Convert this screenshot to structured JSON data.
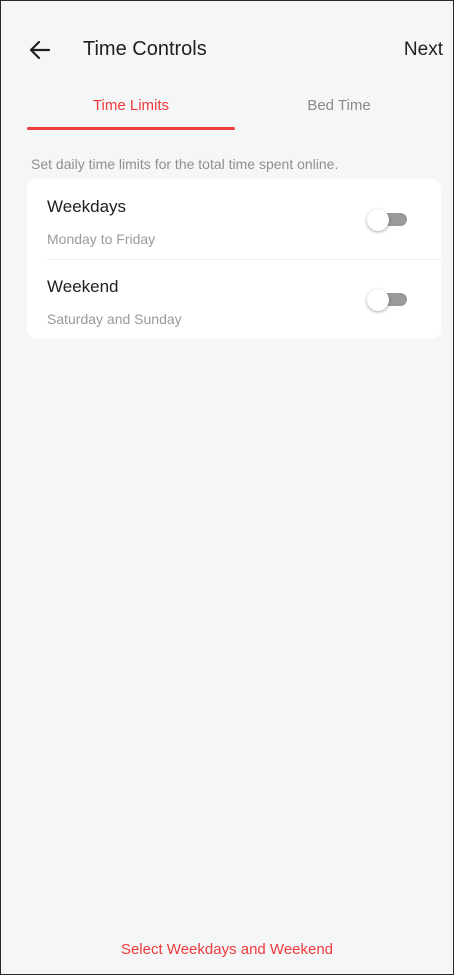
{
  "header": {
    "title": "Time Controls",
    "next_label": "Next",
    "back_icon": "arrow-left-icon"
  },
  "tabs": [
    {
      "label": "Time Limits",
      "active": true
    },
    {
      "label": "Bed Time",
      "active": false
    }
  ],
  "hint": "Set daily time limits for the total time spent online.",
  "schedule": [
    {
      "title": "Weekdays",
      "subtitle": "Monday to Friday",
      "enabled": false
    },
    {
      "title": "Weekend",
      "subtitle": "Saturday and Sunday",
      "enabled": false
    }
  ],
  "footer": {
    "cta_label": "Select Weekdays and Weekend"
  },
  "colors": {
    "accent": "#ef3b3b",
    "background": "#f5f6f8",
    "card": "#ffffff",
    "toggle_off_track": "#9a9a9a"
  }
}
